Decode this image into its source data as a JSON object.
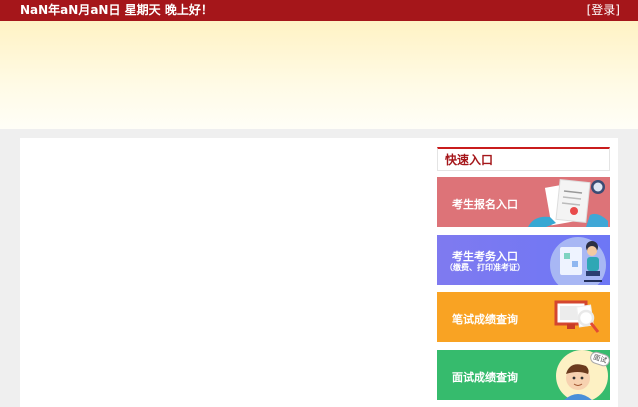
{
  "header": {
    "date_greeting": "NaN年aN月aN日  星期天  晚上好！",
    "login_label": "[登录]"
  },
  "quick_entry": {
    "title": "快速入口",
    "items": [
      {
        "label": "考生报名入口",
        "sub": ""
      },
      {
        "label": "考生考务入口",
        "sub": "（缴费、打印准考证）"
      },
      {
        "label": "笔试成绩查询",
        "sub": ""
      },
      {
        "label": "面试成绩查询",
        "sub": ""
      }
    ],
    "interview_badge": "面试"
  },
  "colors": {
    "topbar": "#a5161a",
    "entry_registration": "#dd7378",
    "entry_exam_affairs": "#7f7af0",
    "entry_written_score": "#f9a323",
    "entry_interview_score": "#36bb6d"
  }
}
